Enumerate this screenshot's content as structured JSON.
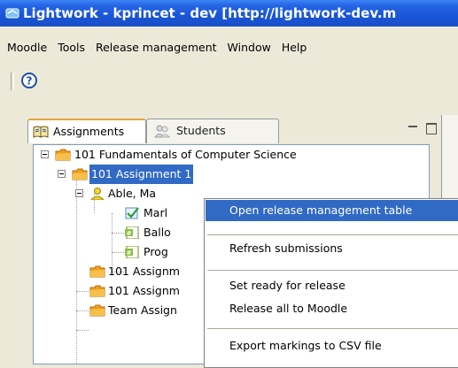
{
  "window": {
    "title": "Lightwork - kprincet - dev [http://lightwork-dev.m"
  },
  "menubar": {
    "items": [
      "Moodle",
      "Tools",
      "Release management",
      "Window",
      "Help"
    ]
  },
  "toolbar": {
    "help_icon": "help-question-icon"
  },
  "tabs": [
    {
      "label": "Assignments",
      "icon": "book-icon",
      "active": true
    },
    {
      "label": "Students",
      "icon": "users-icon",
      "active": false
    }
  ],
  "tree": {
    "course": "101 Fundamentals of Computer Science",
    "assignment_selected": "101 Assignment 1",
    "student": "Able, Ma",
    "files": [
      "Marl",
      "Ballo",
      "Prog"
    ],
    "other_items": [
      "101 Assignm",
      "101 Assignm",
      "Team Assign"
    ]
  },
  "context_menu": {
    "items": [
      {
        "label": "Open release management table",
        "highlighted": true
      },
      {
        "label": "Refresh submissions",
        "highlighted": false
      },
      {
        "label": "Set ready for release",
        "highlighted": false
      },
      {
        "label": "Release all to Moodle",
        "highlighted": false
      },
      {
        "label": "Export markings to CSV file",
        "highlighted": false
      }
    ]
  },
  "colors": {
    "titlebar": "#1955d6",
    "selection": "#316ac5",
    "folder": "#f39b1b"
  }
}
